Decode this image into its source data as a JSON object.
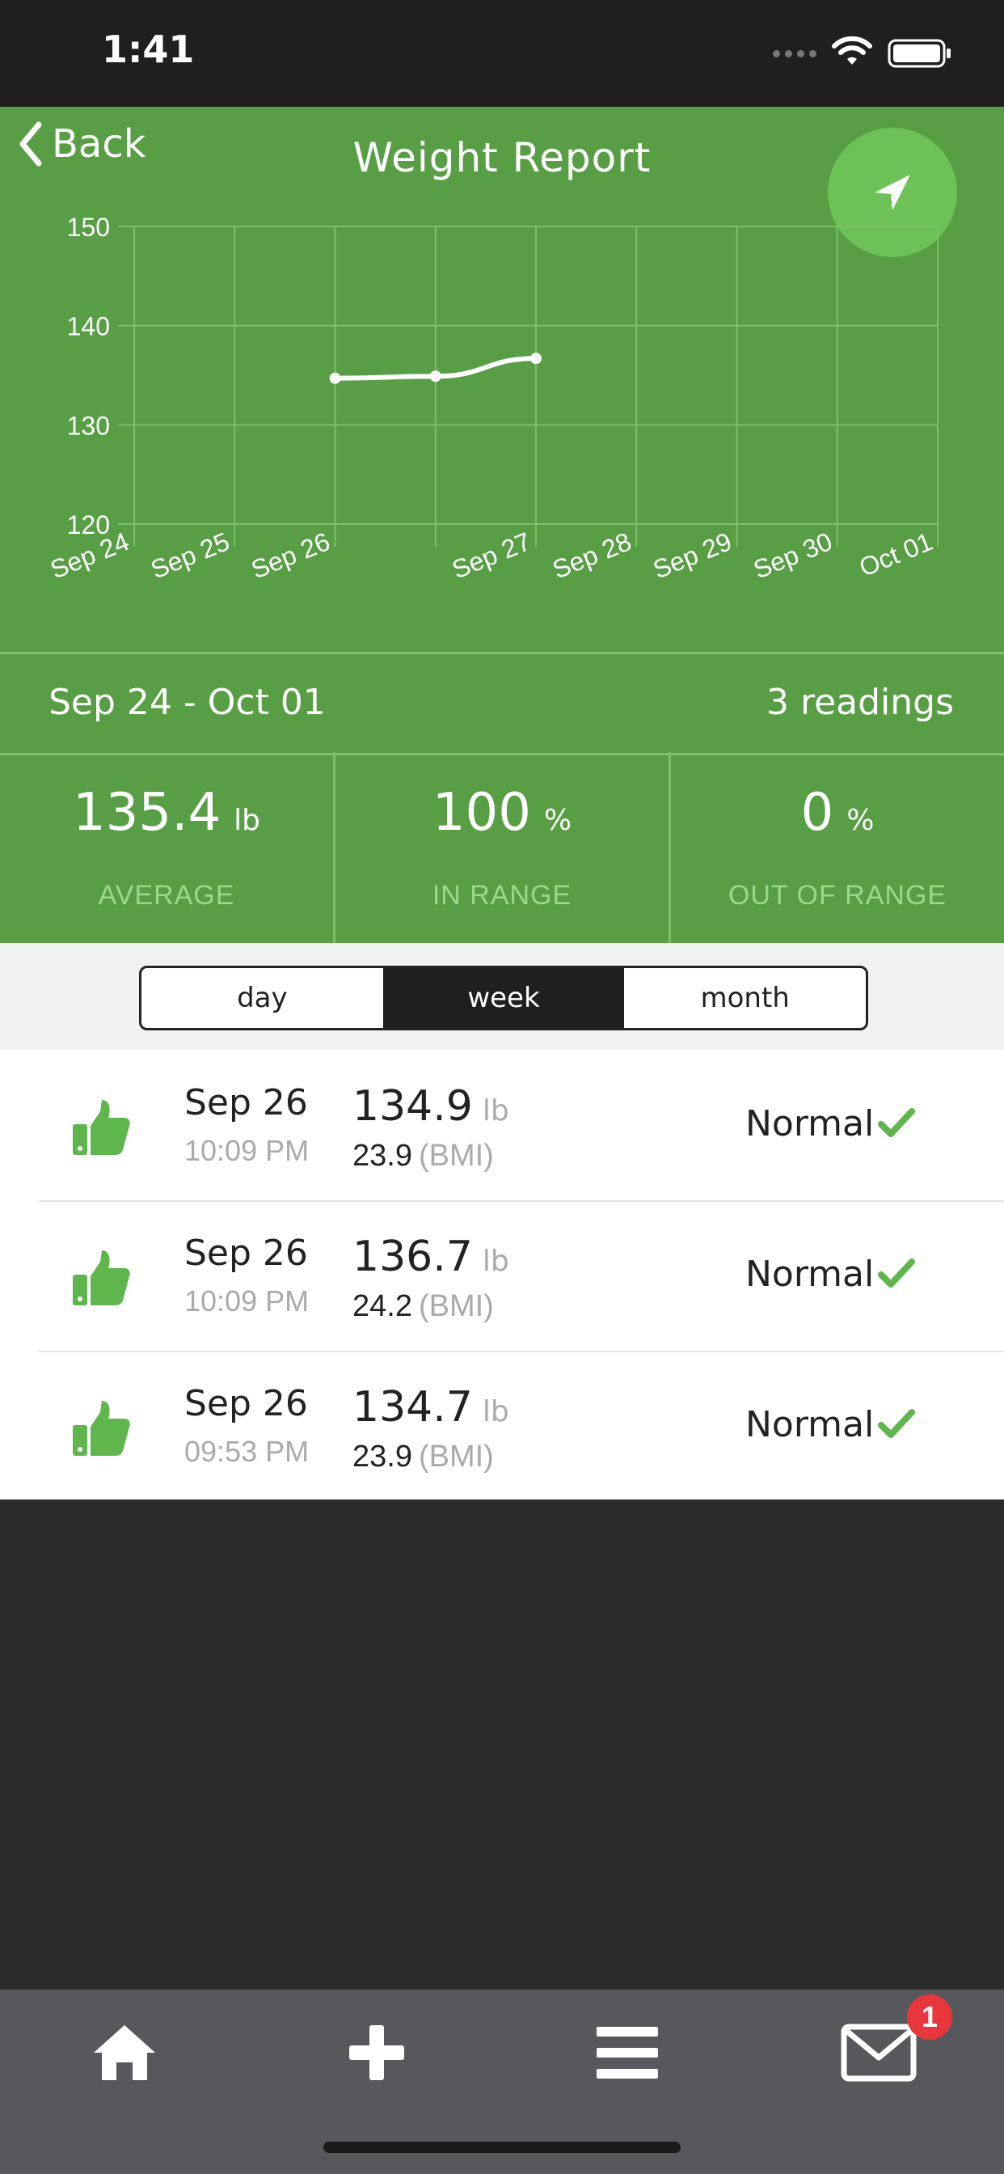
{
  "status_bar": {
    "time": "1:41"
  },
  "header": {
    "back_label": "Back",
    "title": "Weight Report"
  },
  "chart_data": {
    "type": "line",
    "x_categories": [
      "Sep 24",
      "Sep 25",
      "Sep 26",
      "",
      "Sep 27",
      "Sep 28",
      "Sep 29",
      "Sep 30",
      "Oct 01"
    ],
    "series": [
      {
        "points": [
          {
            "xi": 2,
            "y": 134.7
          },
          {
            "xi": 3,
            "y": 134.9
          },
          {
            "xi": 4,
            "y": 136.7
          }
        ]
      }
    ],
    "ylim": [
      120,
      150
    ],
    "y_ticks": [
      120,
      130,
      140,
      150
    ],
    "grid": true
  },
  "summary": {
    "range_label": "Sep 24 - Oct 01",
    "readings": "3 readings"
  },
  "stats": [
    {
      "value": "135.4",
      "unit": "lb",
      "label": "AVERAGE"
    },
    {
      "value": "100",
      "unit": "%",
      "label": "IN RANGE"
    },
    {
      "value": "0",
      "unit": "%",
      "label": "OUT OF RANGE"
    }
  ],
  "segments": {
    "day": "day",
    "week": "week",
    "month": "month",
    "selected": "week"
  },
  "readings": [
    {
      "date": "Sep 26",
      "time": "10:09 PM",
      "weight": "134.9",
      "weight_unit": "lb",
      "bmi": "23.9",
      "bmi_unit": "(BMI)",
      "status": "Normal"
    },
    {
      "date": "Sep 26",
      "time": "10:09 PM",
      "weight": "136.7",
      "weight_unit": "lb",
      "bmi": "24.2",
      "bmi_unit": "(BMI)",
      "status": "Normal"
    },
    {
      "date": "Sep 26",
      "time": "09:53 PM",
      "weight": "134.7",
      "weight_unit": "lb",
      "bmi": "23.9",
      "bmi_unit": "(BMI)",
      "status": "Normal"
    }
  ],
  "tabbar": {
    "mail_badge": "1"
  },
  "colors": {
    "green": "#579e45",
    "accent": "#6cc257",
    "badge": "#e8363c"
  },
  "icons": [
    "back-chevron-icon",
    "send-icon",
    "thumbs-up-icon",
    "check-icon",
    "home-icon",
    "plus-icon",
    "menu-icon",
    "mail-icon",
    "wifi-icon",
    "battery-icon"
  ]
}
